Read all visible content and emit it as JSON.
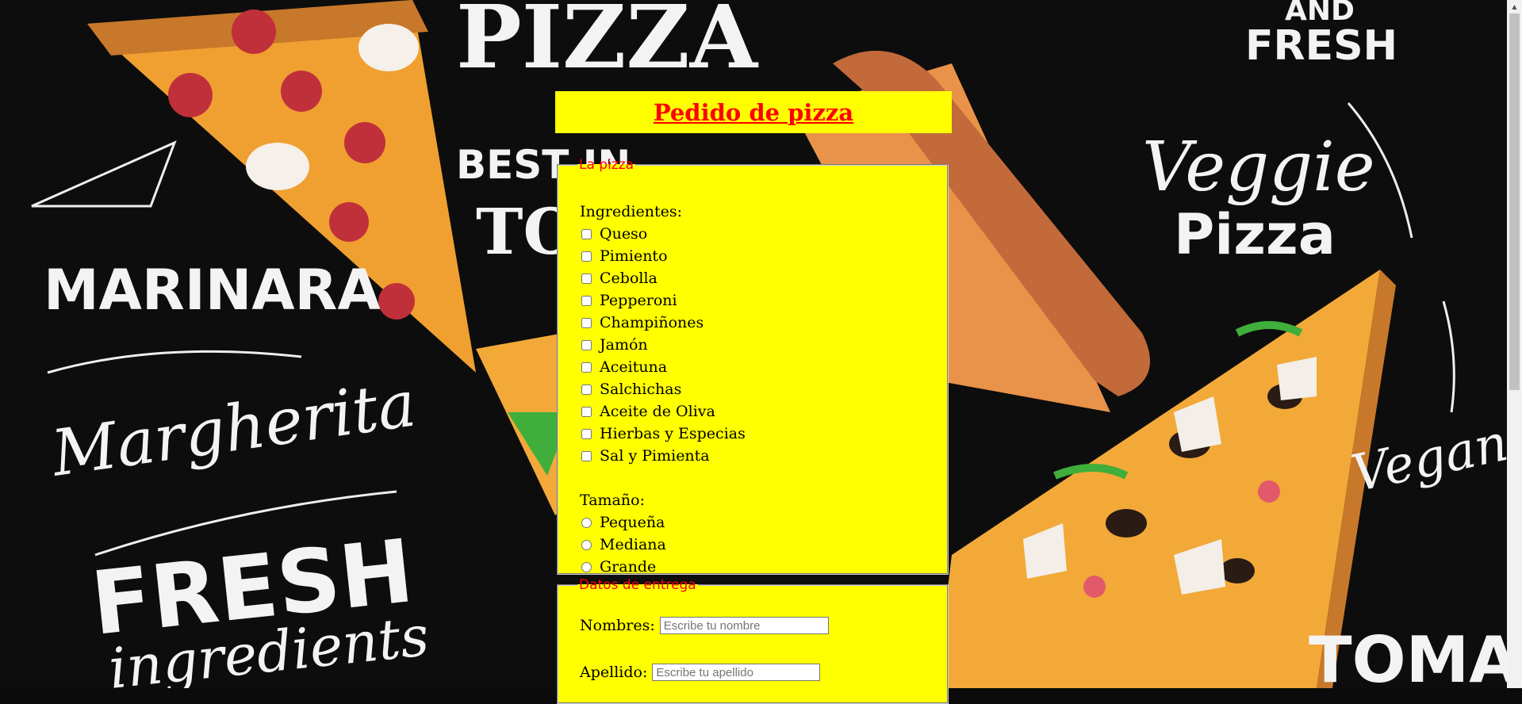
{
  "form": {
    "title": "Pedido de pizza",
    "pizza_section": {
      "legend": "La pizza",
      "ingredients_label": "Ingredientes:",
      "ingredients": [
        "Queso",
        "Pimiento",
        "Cebolla",
        "Pepperoni",
        "Champiñones",
        "Jamón",
        "Aceituna",
        "Salchichas",
        "Aceite de Oliva",
        "Hierbas y Especias",
        "Sal y Pimienta"
      ],
      "size_label": "Tamaño:",
      "sizes": [
        "Pequeña",
        "Mediana",
        "Grande"
      ]
    },
    "delivery_section": {
      "legend": "Datos de entrega",
      "name_label": "Nombres:",
      "name_placeholder": "Escribe tu nombre",
      "surname_label": "Apellido:",
      "surname_placeholder": "Escribe tu apellido"
    }
  },
  "background": {
    "lettering": [
      "PIZZA",
      "AND",
      "FRESH",
      "BEST IN",
      "TO",
      "MARINARA",
      "Margherita",
      "Veggie",
      "Pizza",
      "Vegan",
      "FRESH",
      "ingredients",
      "TOMATO"
    ]
  },
  "colors": {
    "panel": "#ffff00",
    "title": "#ff0000",
    "legend": "#ff0000",
    "page_background": "#0d0d0d"
  }
}
